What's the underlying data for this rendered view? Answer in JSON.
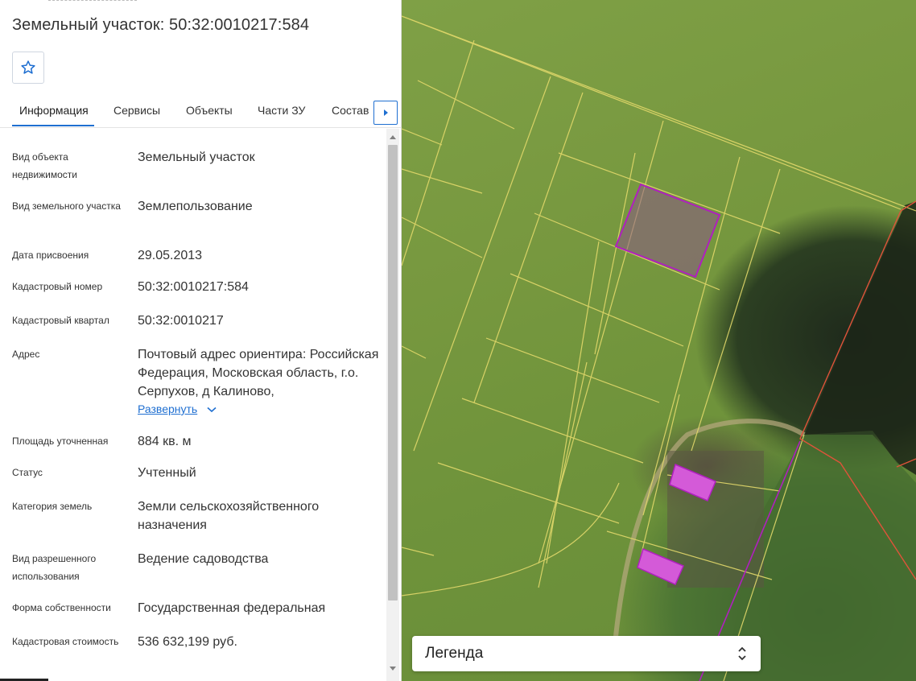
{
  "header": {
    "title": "Земельный участок: 50:32:0010217:584"
  },
  "favorite": {
    "icon": "star-outline-icon"
  },
  "tabs": [
    {
      "label": "Информация",
      "active": true
    },
    {
      "label": "Сервисы",
      "active": false
    },
    {
      "label": "Объекты",
      "active": false
    },
    {
      "label": "Части ЗУ",
      "active": false
    },
    {
      "label": "Состав",
      "active": false
    }
  ],
  "tabs_next_icon": "triangle-right-icon",
  "info": {
    "object_type_label": "Вид объекта недвижимости",
    "object_type_value": "Земельный участок",
    "parcel_type_label": "Вид земельного участка",
    "parcel_type_value": "Землепользование",
    "assign_date_label": "Дата присвоения",
    "assign_date_value": "29.05.2013",
    "cadastral_number_label": "Кадастровый номер",
    "cadastral_number_value": "50:32:0010217:584",
    "cadastral_block_label": "Кадастровый квартал",
    "cadastral_block_value": "50:32:0010217",
    "address_label": "Адрес",
    "address_value": "Почтовый адрес ориентира: Российская Федерация, Московская область, г.о. Серпухов, д Калиново,",
    "address_expand": "Развернуть",
    "area_label": "Площадь уточненная",
    "area_value": "884 кв. м",
    "status_label": "Статус",
    "status_value": "Учтенный",
    "land_category_label": "Категория земель",
    "land_category_value": "Земли сельскохозяйственного назначения",
    "permitted_use_label": "Вид разрешенного использования",
    "permitted_use_value": "Ведение садоводства",
    "ownership_label": "Форма собственности",
    "ownership_value": "Государственная федеральная",
    "cadastral_value_label": "Кадастровая стоимость",
    "cadastral_value_value": "536 632,199 руб."
  },
  "legend": {
    "title": "Легенда",
    "icon": "up-down-chevron-icon"
  },
  "colors": {
    "accent": "#1f6fd1",
    "parcel_border": "#e3d96b",
    "selected_parcel": "#b01fbf",
    "boundary_red": "#e0533a"
  }
}
